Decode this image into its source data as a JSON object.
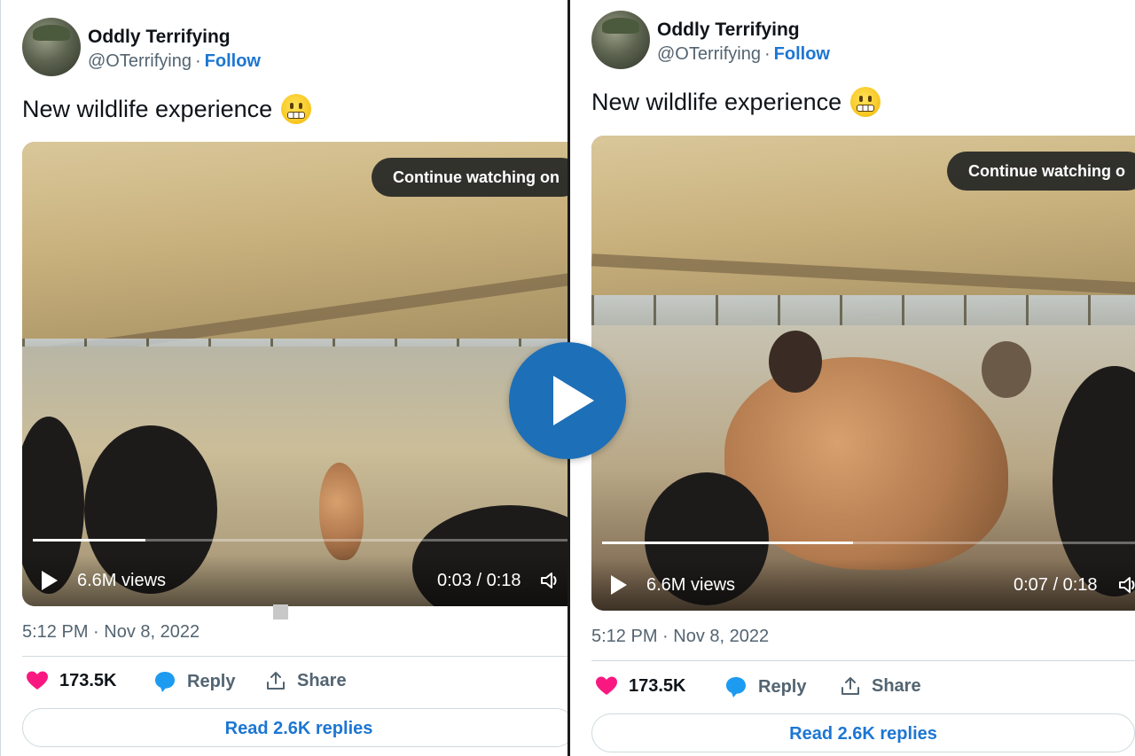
{
  "tweets": [
    {
      "author": {
        "name": "Oddly Terrifying",
        "handle": "@OTerrifying",
        "separator": "·",
        "follow_label": "Follow"
      },
      "text": "New wildlife experience",
      "emoji": "grimacing-face",
      "video": {
        "overlay_label": "Continue watching on",
        "views": "6.6M views",
        "time": "0:03 / 0:18",
        "progress": 0.21
      },
      "timestamp": "5:12 PM · Nov 8, 2022",
      "actions": {
        "likes": "173.5K",
        "reply": "Reply",
        "share": "Share"
      },
      "read_replies": "Read 2.6K replies"
    },
    {
      "author": {
        "name": "Oddly Terrifying",
        "handle": "@OTerrifying",
        "separator": "·",
        "follow_label": "Follow"
      },
      "text": "New wildlife experience",
      "emoji": "grimacing-face",
      "video": {
        "overlay_label": "Continue watching o",
        "views": "6.6M views",
        "time": "0:07 / 0:18",
        "progress": 0.46
      },
      "timestamp": "5:12 PM · Nov 8, 2022",
      "actions": {
        "likes": "173.5K",
        "reply": "Reply",
        "share": "Share"
      },
      "read_replies": "Read 2.6K replies"
    }
  ],
  "colors": {
    "link": "#1d76d3",
    "heart": "#f91880",
    "reply_bubble": "#1d9bf0",
    "play_button": "#1d6fb8"
  }
}
